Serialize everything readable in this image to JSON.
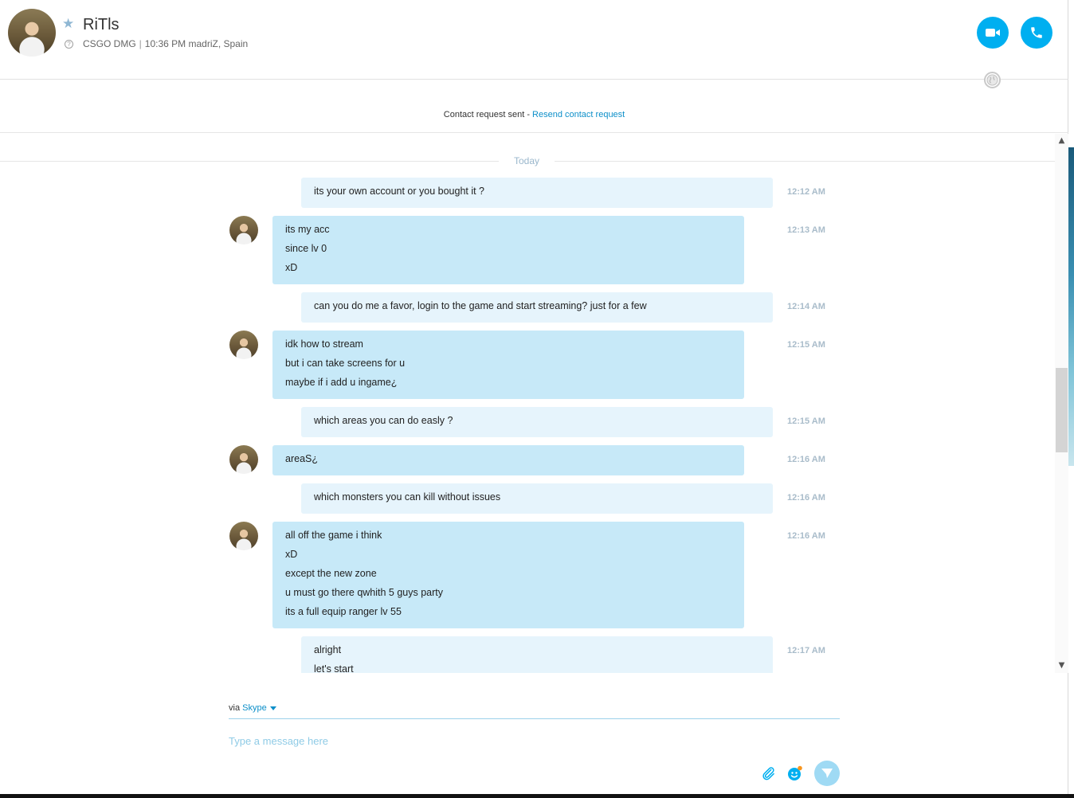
{
  "header": {
    "contact_name": "RiTls",
    "mood": "CSGO DMG",
    "separator": "|",
    "time_location": "10:36 PM madriZ, Spain",
    "mood_icon_glyph": "?",
    "accent_color": "#00aff0"
  },
  "notice": {
    "text": "Contact request sent - ",
    "link": "Resend contact request"
  },
  "conversation": {
    "date_label": "Today",
    "messages": [
      {
        "direction": "out",
        "lines": [
          "its your own account or you bought it ?"
        ],
        "time": "12:12 AM"
      },
      {
        "direction": "in",
        "lines": [
          "its my acc",
          "since lv 0",
          "xD"
        ],
        "time": "12:13 AM"
      },
      {
        "direction": "out",
        "lines": [
          "can you do me a favor, login to the game and start streaming? just for a few"
        ],
        "time": "12:14 AM"
      },
      {
        "direction": "in",
        "lines": [
          "idk how to stream",
          "but i can take screens for u",
          "maybe if i add u ingame¿"
        ],
        "time": "12:15 AM"
      },
      {
        "direction": "out",
        "lines": [
          "which areas you can do easly ?"
        ],
        "time": "12:15 AM"
      },
      {
        "direction": "in",
        "lines": [
          "areaS¿"
        ],
        "time": "12:16 AM"
      },
      {
        "direction": "out",
        "lines": [
          "which monsters you can kill without issues"
        ],
        "time": "12:16 AM"
      },
      {
        "direction": "in",
        "lines": [
          "all off the game i think",
          "xD",
          "except the new zone",
          "u must go there qwhith 5 guys party",
          "its a full equip ranger lv 55"
        ],
        "time": "12:16 AM"
      },
      {
        "direction": "out",
        "lines": [
          "alright",
          "let's start"
        ],
        "time": "12:17 AM"
      }
    ]
  },
  "composer": {
    "via_label": "via",
    "via_service": "Skype",
    "placeholder": "Type a message here"
  },
  "icons": [
    "star-icon",
    "help-icon",
    "video-call-icon",
    "phone-icon",
    "globe-icon",
    "paperclip-icon",
    "emoji-icon",
    "send-icon",
    "chevron-up-icon",
    "chevron-down-icon"
  ]
}
